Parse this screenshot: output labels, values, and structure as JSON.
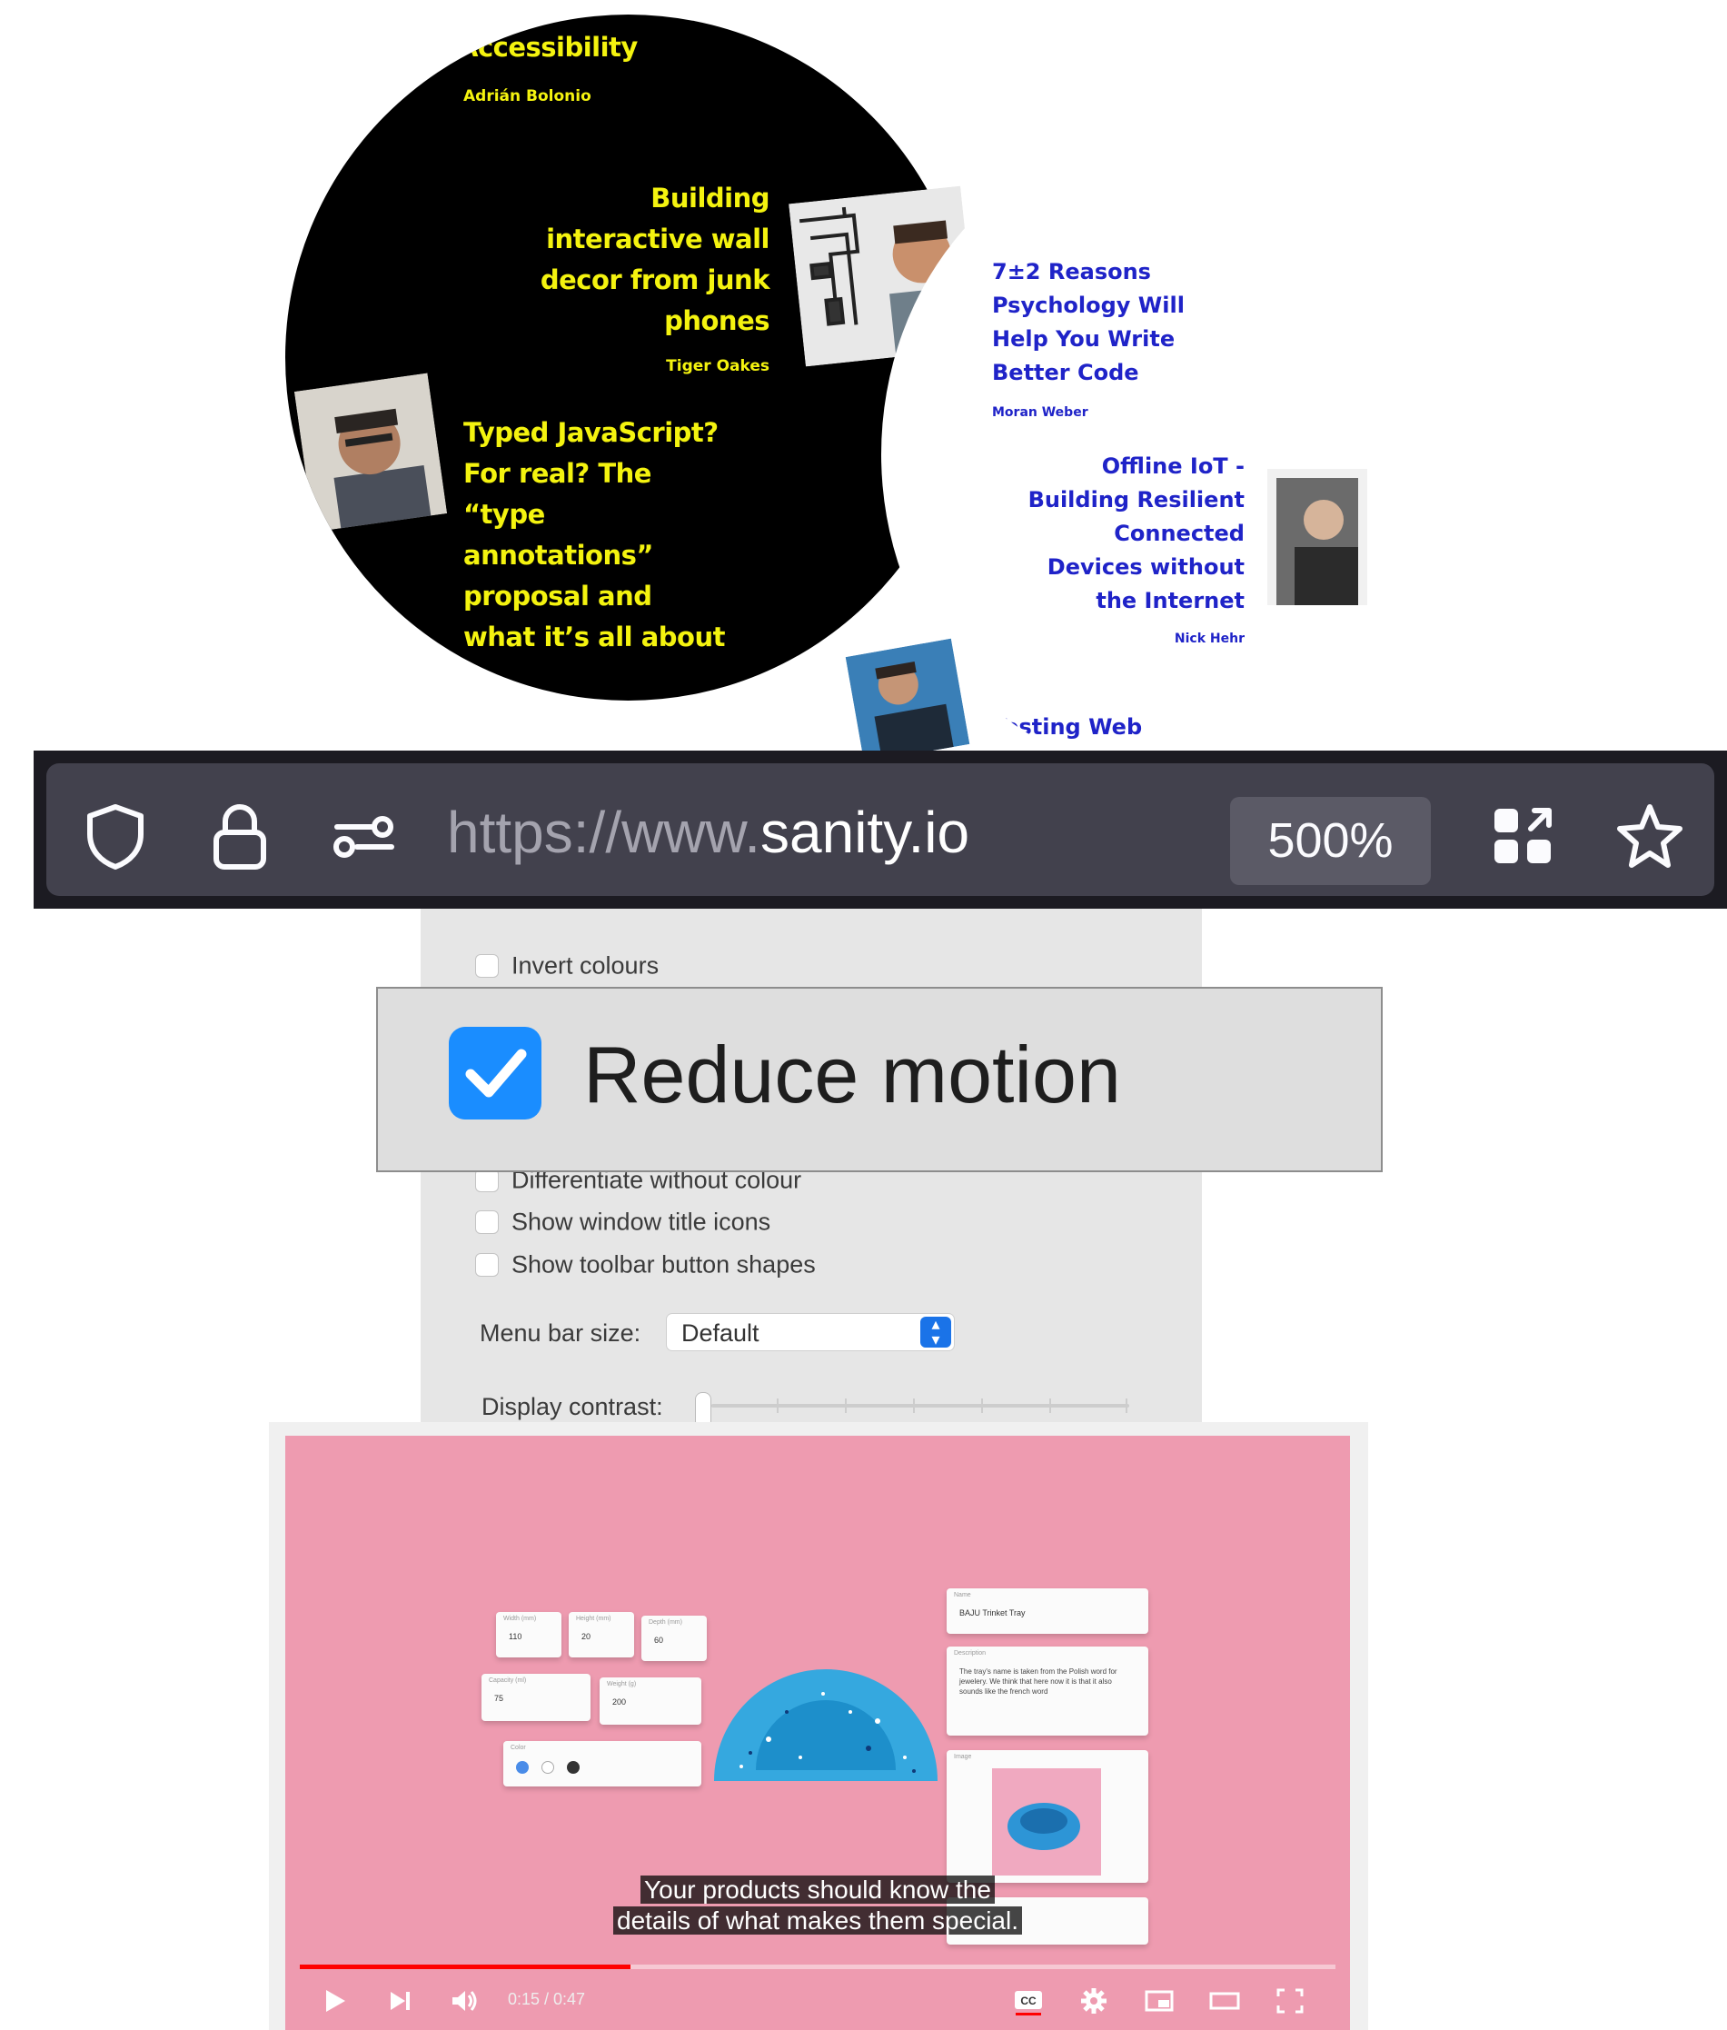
{
  "talks": {
    "t1": {
      "title_lines": [
        "Accessibility"
      ],
      "speaker": "Adrián Bolonio"
    },
    "t2": {
      "title_lines": [
        "Building",
        "interactive wall",
        "decor from junk",
        "phones"
      ],
      "speaker": "Tiger Oakes"
    },
    "t3": {
      "title_lines": [
        "Typed JavaScript?",
        "For real? The",
        "“type",
        "annotations”",
        "proposal and",
        "what it’s all about"
      ],
      "speaker": ""
    },
    "t4": {
      "title_lines": [
        "7±2 Reasons",
        "Psychology Will",
        "Help You Write",
        "Better Code"
      ],
      "speaker": "Moran Weber"
    },
    "t5": {
      "title_lines": [
        "Offline IoT -",
        "Building Resilient",
        "Connected",
        "Devices without",
        "the Internet"
      ],
      "speaker": "Nick Hehr"
    },
    "t6": {
      "title_lines": [
        "Testing Web"
      ],
      "speaker": ""
    }
  },
  "urlbar": {
    "url_prefix": "https://www.",
    "url_host": "sanity.io",
    "zoom": "500%",
    "icons": [
      "shield-icon",
      "lock-icon",
      "permissions-icon",
      "extensions-icon",
      "star-icon"
    ]
  },
  "settings": {
    "invert_colours": "Invert colours",
    "reduce_motion": "Reduce motion",
    "reduce_motion_checked": true,
    "differentiate": "Differentiate without colour",
    "window_title_icons": "Show window title icons",
    "toolbar_shapes": "Show toolbar button shapes",
    "menu_bar_size_label": "Menu bar size:",
    "menu_bar_size_value": "Default",
    "display_contrast_label": "Display contrast:",
    "display_contrast_level": 0
  },
  "video": {
    "caption_line1": "Your products should know the",
    "caption_line2": "details of what makes them special.",
    "timecode": "0:15 / 0:47",
    "progress": 0.319,
    "accent": "#ff0000",
    "cards": {
      "width_label": "Width (mm)",
      "width_value": "110",
      "height_label": "Height (mm)",
      "height_value": "20",
      "depth_label": "Depth (mm)",
      "depth_value": "60",
      "capacity_label": "Capacity (ml)",
      "capacity_value": "75",
      "weight_label": "Weight (g)",
      "weight_value": "200",
      "color_label": "Color",
      "name_label": "Name",
      "name_value": "BAJU Trinket Tray",
      "description_label": "Description",
      "description_value": "The tray's name is taken from the Polish word for jewelery. We think that here now it is that it also sounds like the french word",
      "image_label": "Image"
    }
  }
}
